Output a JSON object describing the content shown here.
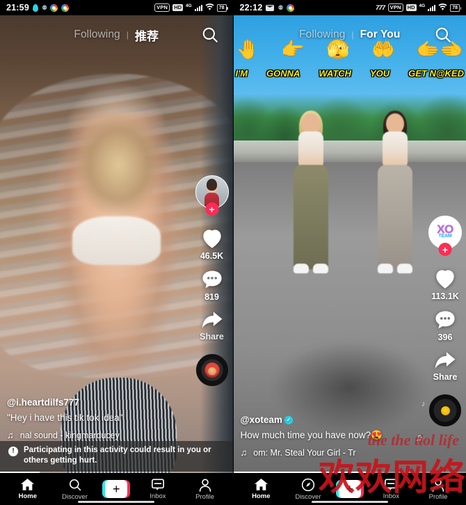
{
  "left_phone": {
    "status_bar": {
      "time": "21:59",
      "icons_left": [
        "water-drop-icon",
        "shield-icon",
        "chrome-icon",
        "chrome-icon-2"
      ],
      "icons_right": [
        "vpn-badge",
        "hd-badge",
        "4g-signal",
        "wifi-icon",
        "battery"
      ],
      "vpn_label": "VPN",
      "hd_label": "HD",
      "network_label": "4G",
      "battery_level": "78"
    },
    "topbar": {
      "tab_following": "Following",
      "divider": "|",
      "tab_foryou": "推荐",
      "search_icon": "search-icon"
    },
    "rail": {
      "follow_plus": "+",
      "like_count": "46.5K",
      "comment_count": "819",
      "share_label": "Share"
    },
    "caption": {
      "username": "@i.heartdilfs777",
      "verified": false,
      "text": "\"Hey i have this tik tok idea\"",
      "music_note": "♫",
      "music": "nal sound - kingmarducey"
    },
    "warning": {
      "icon": "exclamation-icon",
      "text": "Participating in this activity could result in you or others getting hurt."
    },
    "progress_percent": 17,
    "bottom_nav": [
      {
        "icon": "home-icon",
        "label": "Home",
        "active": true
      },
      {
        "icon": "search-icon",
        "label": "Discover",
        "active": false
      },
      {
        "icon": "plus-icon",
        "label": "",
        "active": false
      },
      {
        "icon": "inbox-icon",
        "label": "Inbox",
        "active": false
      },
      {
        "icon": "profile-icon",
        "label": "Profile",
        "active": false
      }
    ]
  },
  "right_phone": {
    "status_bar": {
      "time": "22:12",
      "icons_left": [
        "mail-icon",
        "shield-icon",
        "chrome-icon"
      ],
      "icons_right": [
        "777-icon",
        "vpn-badge",
        "hd-badge",
        "4g-signal",
        "wifi-icon",
        "battery"
      ],
      "speed_label": "777",
      "vpn_label": "VPN",
      "hd_label": "HD",
      "network_label": "4G",
      "battery_level": "78"
    },
    "topbar": {
      "tab_following": "Following",
      "divider": "|",
      "tab_foryou": "For You",
      "search_icon": "search-icon"
    },
    "overlay": {
      "emojis": [
        "🤚",
        "👉",
        "🫣",
        "🤲",
        "🫱🫲"
      ],
      "words": [
        "I'M",
        "GONNA",
        "WATCH",
        "YOU",
        "GET N@KED"
      ]
    },
    "rail": {
      "avatar_text": "XO",
      "avatar_subtext": "TEAM",
      "follow_plus": "+",
      "like_count": "113.1K",
      "comment_count": "396",
      "share_label": "Share"
    },
    "caption": {
      "username": "@xoteam",
      "verified": true,
      "verified_glyph": "✓",
      "text": "How much time you have now?😍",
      "music_note": "♫",
      "music": "om: Mr. Steal Your Girl - Tr",
      "floating_note": "♫"
    },
    "progress_percent": 58,
    "bottom_nav": [
      {
        "icon": "home-icon",
        "label": "Home",
        "active": true
      },
      {
        "icon": "compass-icon",
        "label": "Discover",
        "active": false
      },
      {
        "icon": "plus-icon",
        "label": "",
        "active": false
      },
      {
        "icon": "inbox-icon",
        "label": "Inbox",
        "active": false
      },
      {
        "icon": "profile-icon",
        "label": "Profile",
        "active": false
      }
    ]
  },
  "watermark": {
    "text": "欢欢网络",
    "color": "#c8141b",
    "script_text": "the the tiol life"
  },
  "theme": {
    "accent_pink": "#fe2c55",
    "accent_cyan": "#2ce5ea",
    "verified_blue": "#20d5ec",
    "caption_yellow": "#f7ee1d"
  }
}
